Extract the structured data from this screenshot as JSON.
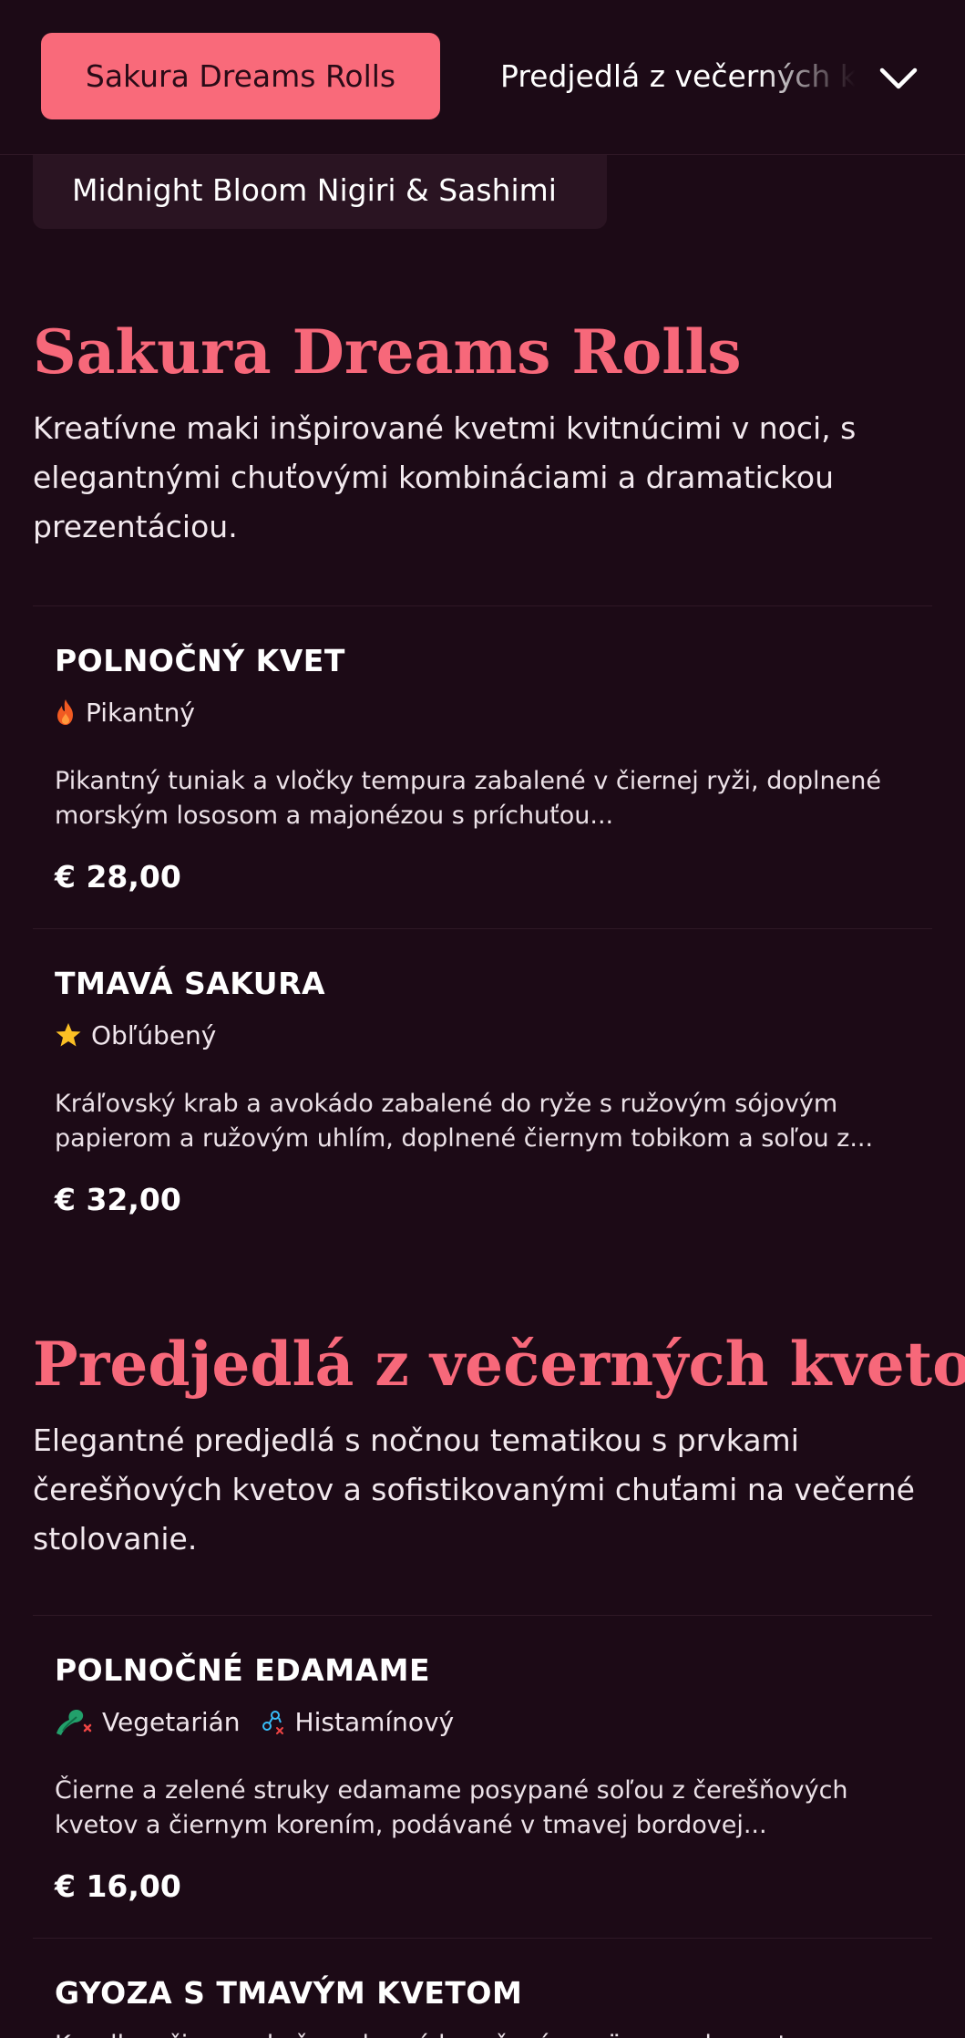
{
  "nav": {
    "active_tab": "Sakura Dreams Rolls",
    "next_tab": "Predjedlá z večerných kvetov",
    "peek_tab": "Midnight Bloom Nigiri & Sashimi"
  },
  "sections": [
    {
      "title": "Sakura Dreams Rolls",
      "description": "Kreatívne maki inšpirované kvetmi kvitnúcimi v noci, s elegantnými chuťovými kombináciami a dramatickou prezentáciou.",
      "items": [
        {
          "name": "POLNOČNÝ KVET",
          "tags": [
            {
              "label": "Pikantný",
              "icon": "flame-icon"
            }
          ],
          "description": "Pikantný tuniak a vločky tempura zabalené v čiernej ryži, doplnené morským lososom a majonézou s príchuťou...",
          "price": "€ 28,00"
        },
        {
          "name": "TMAVÁ SAKURA",
          "tags": [
            {
              "label": "Obľúbený",
              "icon": "star-icon"
            }
          ],
          "description": "Kráľovský krab a avokádo zabalené do ryže s ružovým sójovým papierom a ružovým uhlím, doplnené čiernym tobikom a soľou z...",
          "price": "€ 32,00"
        }
      ]
    },
    {
      "title": "Predjedlá z večerných kvetov",
      "description": "Elegantné predjedlá s nočnou tematikou s prvkami čerešňových kvetov a sofistikovanými chuťami na večerné stolovanie.",
      "items": [
        {
          "name": "POLNOČNÉ EDAMAME",
          "tags": [
            {
              "label": "Vegetarián",
              "icon": "vegetarian-icon"
            },
            {
              "label": "Histamínový",
              "icon": "histamine-icon"
            }
          ],
          "description": "Čierne a zelené struky edamame posypané soľou z čerešňových kvetov a čiernym korením, podávané v tmavej bordovej...",
          "price": "€ 16,00"
        },
        {
          "name": "GYOZA S TMAVÝM KVETOM",
          "description": "Knedle s čiernou kožou plnené bravčovým mäsom a kapustou s..."
        }
      ]
    }
  ],
  "colors": {
    "background": "#1c0a16",
    "accent": "#f96a7a",
    "title": "#f7687a"
  }
}
